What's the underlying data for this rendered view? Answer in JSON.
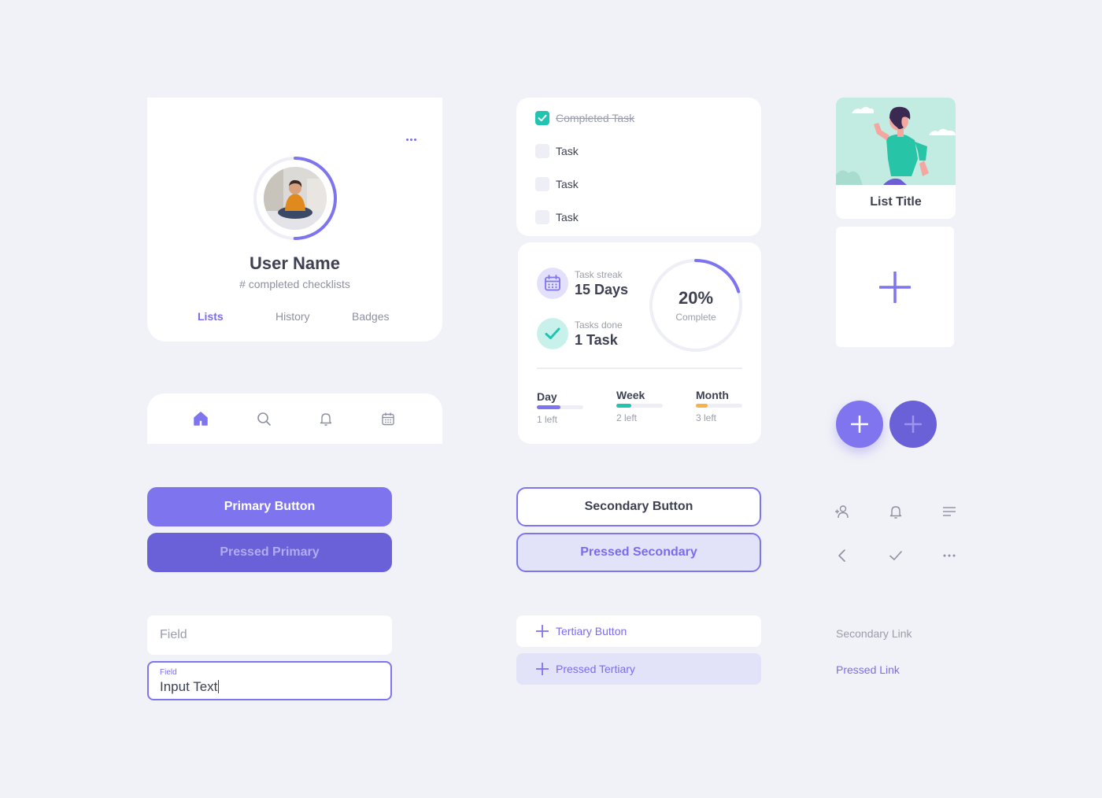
{
  "colors": {
    "accent": "#7e74ee",
    "accent_pressed": "#6a60d8",
    "teal": "#21c4b0",
    "orange": "#f8b24a",
    "background": "#f1f2f7"
  },
  "profile": {
    "name": "User Name",
    "subtitle": "# completed checklists",
    "progress_percent": 50,
    "tabs": [
      {
        "label": "Lists",
        "active": true
      },
      {
        "label": "History",
        "active": false
      },
      {
        "label": "Badges",
        "active": false
      }
    ]
  },
  "navbar": {
    "items": [
      "home-icon",
      "search-icon",
      "bell-icon",
      "calendar-icon"
    ],
    "active": "home-icon"
  },
  "buttons": {
    "primary": "Primary Button",
    "primary_pressed": "Pressed Primary",
    "secondary": "Secondary Button",
    "secondary_pressed": "Pressed Secondary",
    "tertiary": "Tertiary Button",
    "tertiary_pressed": "Pressed Tertiary"
  },
  "fields": {
    "empty_placeholder": "Field",
    "filled_label": "Field",
    "filled_value": "Input Text"
  },
  "tasks": [
    {
      "label": "Completed Task",
      "done": true
    },
    {
      "label": "Task",
      "done": false
    },
    {
      "label": "Task",
      "done": false
    },
    {
      "label": "Task",
      "done": false
    }
  ],
  "stats": {
    "streak_label": "Task streak",
    "streak_value": "15 Days",
    "done_label": "Tasks done",
    "done_value": "1 Task",
    "percent_text": "20%",
    "percent_value": 20,
    "percent_label": "Complete",
    "periods": [
      {
        "name": "Day",
        "left": "1 left",
        "progress": 0.5,
        "color": "#7e74ee"
      },
      {
        "name": "Week",
        "left": "2 left",
        "progress": 0.33,
        "color": "#21c4b0"
      },
      {
        "name": "Month",
        "left": "3 left",
        "progress": 0.25,
        "color": "#f8b24a"
      }
    ]
  },
  "list_card": {
    "title": "List Title"
  },
  "icons_grid": [
    "add-user-icon",
    "bell-icon",
    "menu-lines-icon",
    "chevron-left-icon",
    "check-icon",
    "more-dots-icon"
  ],
  "links": {
    "secondary": "Secondary Link",
    "pressed": "Pressed Link"
  }
}
